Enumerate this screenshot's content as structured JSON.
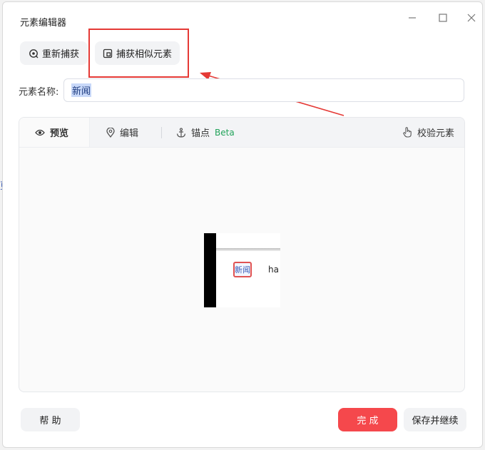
{
  "window": {
    "title": "元素编辑器"
  },
  "toolbar": {
    "recapture_label": "重新捕获",
    "capture_similar_label": "捕获相似元素"
  },
  "element_name": {
    "label": "元素名称:",
    "value": "新闻"
  },
  "tabs": [
    {
      "label": "预览",
      "icon": "eye-icon",
      "active": true
    },
    {
      "label": "编辑",
      "icon": "location-pin-icon",
      "active": false
    },
    {
      "label": "锚点",
      "icon": "anchor-icon",
      "active": false,
      "badge": "Beta"
    }
  ],
  "validate": {
    "label": "校验元素",
    "icon": "hand-pointer-icon"
  },
  "preview": {
    "selected_text": "新闻",
    "neighbor_text": "ha"
  },
  "footer": {
    "help_label": "帮 助",
    "done_label": "完 成",
    "save_continue_label": "保存并继续"
  },
  "colors": {
    "accent_red": "#f5484c",
    "annotation_red": "#e53935",
    "beta_green": "#22a35a"
  }
}
